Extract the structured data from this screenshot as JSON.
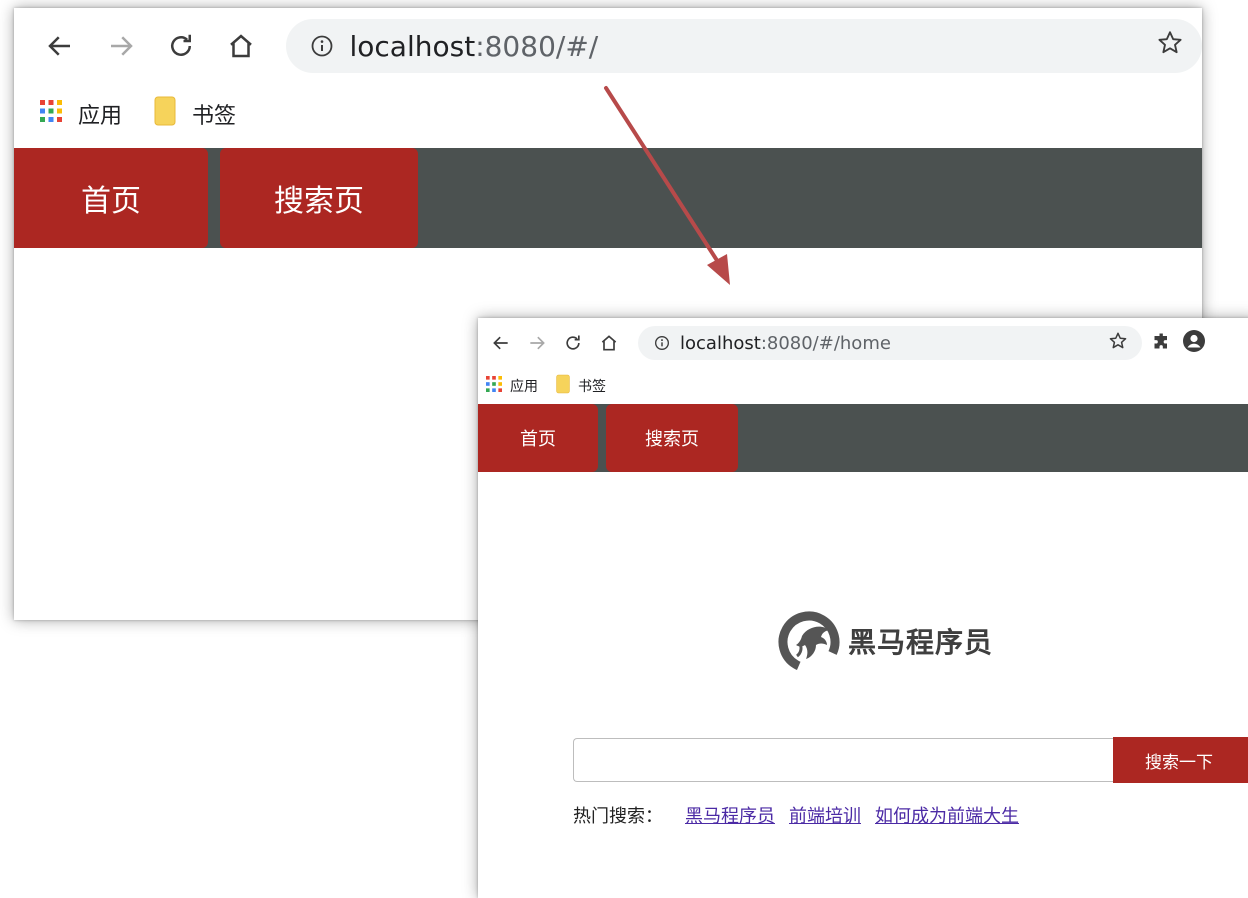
{
  "window_back": {
    "url_host": "localhost",
    "url_rest": ":8080/#/",
    "bookmarks": [
      "应用",
      "书签"
    ],
    "tabs": [
      "首页",
      "搜索页"
    ]
  },
  "window_front": {
    "url_host": "localhost",
    "url_rest": ":8080/#/home",
    "bookmarks": [
      "应用",
      "书签"
    ],
    "tabs": [
      "首页",
      "搜索页"
    ],
    "logo_text": "黑马程序员",
    "search": {
      "value": "",
      "button_label": "搜索一下"
    },
    "hot_search": {
      "label": "热门搜索：",
      "links": [
        "黑马程序员",
        "前端培训",
        "如何成为前端大生"
      ]
    }
  },
  "colors": {
    "tab_red": "#ac2722",
    "navbar_gray": "#4b5150",
    "arrow": "#b74a4a",
    "link_purple": "#4b2aa5"
  },
  "icons": [
    "back-arrow-icon",
    "forward-arrow-icon",
    "reload-icon",
    "home-icon",
    "info-icon",
    "star-icon",
    "puzzle-icon",
    "profile-icon",
    "apps-grid-icon",
    "folder-icon"
  ]
}
